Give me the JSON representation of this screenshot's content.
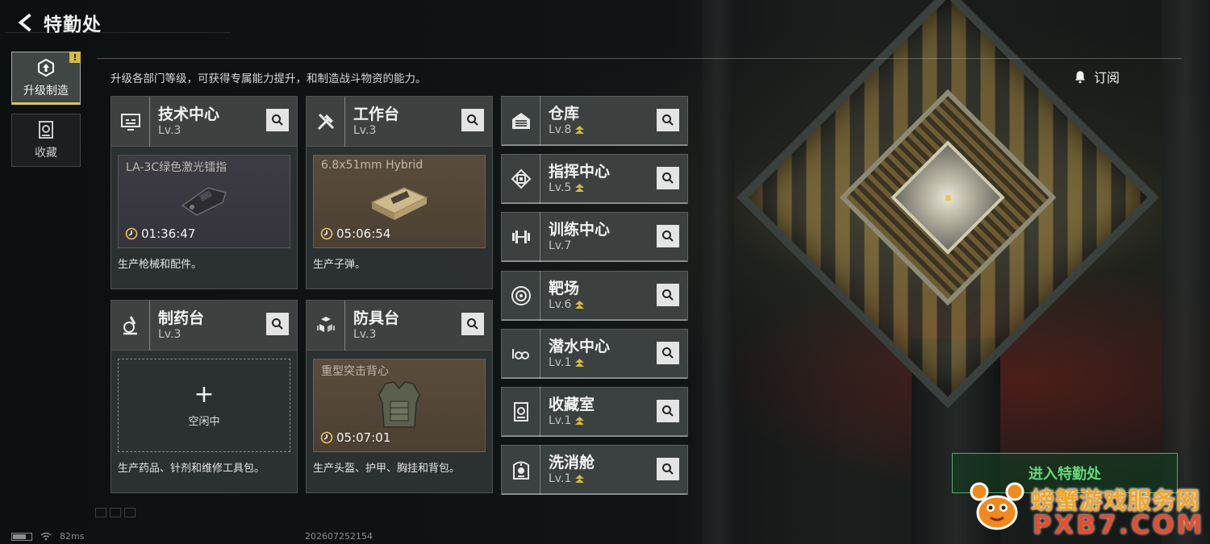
{
  "header": {
    "title": "特勤处"
  },
  "nav": [
    {
      "label": "升级制造",
      "icon": "upgrade-icon",
      "active": true,
      "badge": "!"
    },
    {
      "label": "收藏",
      "icon": "collection-icon",
      "active": false
    }
  ],
  "description": "升级各部门等级，可获得专属能力提升，和制造战斗物资的能力。",
  "subscribe_label": "订阅",
  "production_cards": [
    {
      "name": "技术中心",
      "level": "Lv.3",
      "icon": "monitor-icon",
      "slot": {
        "item": "LA-3C绿色激光镭指",
        "timer": "01:36:47",
        "state": "producing"
      },
      "footer": "生产枪械和配件。"
    },
    {
      "name": "工作台",
      "level": "Lv.3",
      "icon": "tools-icon",
      "slot": {
        "item": "6.8x51mm Hybrid",
        "timer": "05:06:54",
        "state": "producing"
      },
      "footer": "生产子弹。"
    },
    {
      "name": "制药台",
      "level": "Lv.3",
      "icon": "microscope-icon",
      "slot": {
        "idle_label": "空闲中",
        "state": "idle"
      },
      "footer": "生产药品、针剂和维修工具包。"
    },
    {
      "name": "防具台",
      "level": "Lv.3",
      "icon": "armor-blocks-icon",
      "slot": {
        "item": "重型突击背心",
        "timer": "05:07:01",
        "state": "producing"
      },
      "footer": "生产头盔、护甲、胸挂和背包。"
    }
  ],
  "facilities": [
    {
      "name": "仓库",
      "level": "Lv.8",
      "icon": "warehouse-icon",
      "upgradable": true
    },
    {
      "name": "指挥中心",
      "level": "Lv.5",
      "icon": "chip-icon",
      "upgradable": true
    },
    {
      "name": "训练中心",
      "level": "Lv.7",
      "icon": "dumbbell-icon",
      "upgradable": false
    },
    {
      "name": "靶场",
      "level": "Lv.6",
      "icon": "target-icon",
      "upgradable": true
    },
    {
      "name": "潜水中心",
      "level": "Lv.1",
      "icon": "diving-mask-icon",
      "upgradable": true
    },
    {
      "name": "收藏室",
      "level": "Lv.1",
      "icon": "collection-room-icon",
      "upgradable": true
    },
    {
      "name": "洗消舱",
      "level": "Lv.1",
      "icon": "decon-icon",
      "upgradable": true
    }
  ],
  "enter_button": "进入特勤处",
  "watermark": {
    "line1": "螃蟹游戏服务网",
    "line2": "PXB7.COM"
  },
  "status_bar": {
    "ping": "82ms",
    "build": "202607252154"
  },
  "colors": {
    "accent_gold": "#d9c45a",
    "enter_green": "#64d87c",
    "upgrade_arrow": "#d9b842"
  }
}
